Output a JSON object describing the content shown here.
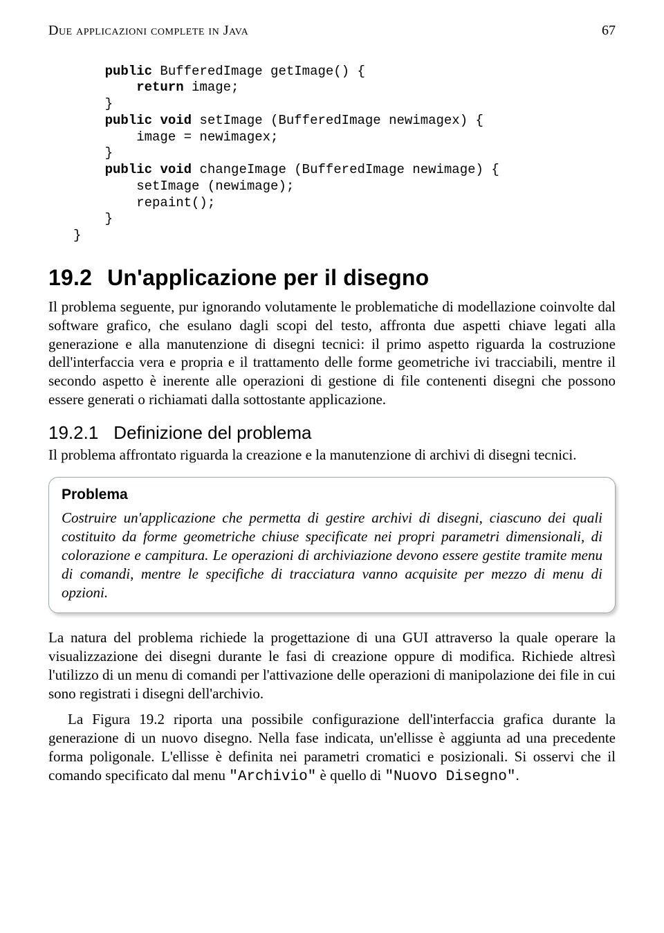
{
  "header": {
    "running_title": "Due applicazioni complete in Java",
    "page_number": "67"
  },
  "code": {
    "lines": [
      {
        "indent": 1,
        "tokens": [
          "public",
          " BufferedImage getImage() {"
        ]
      },
      {
        "indent": 2,
        "tokens": [
          "return",
          " image;"
        ]
      },
      {
        "indent": 1,
        "tokens": [
          "}"
        ]
      },
      {
        "indent": 1,
        "tokens": [
          "public",
          " ",
          "void",
          " setImage (BufferedImage newimagex) {"
        ]
      },
      {
        "indent": 2,
        "tokens": [
          "image = newimagex;"
        ]
      },
      {
        "indent": 1,
        "tokens": [
          "}"
        ]
      },
      {
        "indent": 1,
        "tokens": [
          "public",
          " ",
          "void",
          " changeImage (BufferedImage newimage) {"
        ]
      },
      {
        "indent": 2,
        "tokens": [
          "setImage (newimage);"
        ]
      },
      {
        "indent": 2,
        "tokens": [
          "repaint();"
        ]
      },
      {
        "indent": 1,
        "tokens": [
          "}"
        ]
      },
      {
        "indent": 0,
        "tokens": [
          "}"
        ]
      }
    ],
    "keywords": [
      "public",
      "return",
      "void"
    ]
  },
  "section_19_2": {
    "number": "19.2",
    "title": "Un'applicazione per il disegno",
    "paragraph": "Il problema seguente, pur ignorando volutamente le problematiche di modellazione coinvolte dal software grafico, che esulano dagli scopi del testo, affronta due aspetti chiave legati alla generazione e alla manutenzione di disegni tecnici: il primo aspetto riguarda la costruzione dell'interfaccia vera e propria e il trattamento delle forme geometriche ivi tracciabili, mentre il secondo aspetto è inerente alle operazioni di gestione di file contenenti disegni che possono essere generati o richiamati dalla sottostante applicazione."
  },
  "section_19_2_1": {
    "number": "19.2.1",
    "title": "Definizione del problema",
    "paragraph": "Il problema affrontato riguarda la creazione e la manutenzione di archivi di disegni tecnici."
  },
  "callout": {
    "title": "Problema",
    "body": "Costruire un'applicazione che permetta di gestire archivi di disegni, ciascuno dei quali costituito da forme geometriche chiuse specificate nei propri parametri dimensionali, di colorazione e campitura. Le operazioni di archiviazione devono essere gestite tramite menu di comandi, mentre le specifiche di tracciatura vanno acquisite per mezzo di menu di opzioni."
  },
  "after_callout": {
    "para1": "La natura del problema richiede la progettazione di una GUI attraverso la quale operare la visualizzazione dei disegni durante le fasi di creazione oppure di modifica. Richiede altresì l'utilizzo di un menu di comandi per l'attivazione delle operazioni di manipolazione dei file in cui sono registrati i disegni dell'archivio.",
    "para2_pre": "La Figura 19.2 riporta una possibile configurazione dell'interfaccia grafica durante la generazione di un nuovo disegno. Nella fase indicata, un'ellisse è aggiunta ad una precedente forma poligonale. L'ellisse è definita nei parametri cromatici e posizionali. Si osservi che il comando specificato dal menu ",
    "mono1": "\"Archivio\"",
    "mid": " è quello di ",
    "mono2": "\"Nuovo Disegno\"",
    "end": "."
  }
}
